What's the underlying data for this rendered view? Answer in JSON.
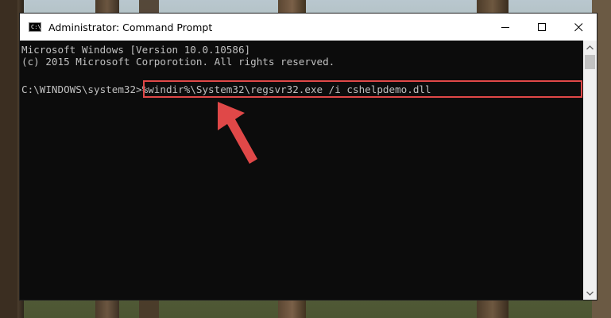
{
  "window": {
    "title": "Administrator: Command Prompt",
    "icon": "cmd-icon"
  },
  "controls": {
    "minimize": "minimize-icon",
    "maximize": "maximize-icon",
    "close": "close-icon"
  },
  "console": {
    "lines": [
      "Microsoft Windows [Version 10.0.10586]",
      "(c) 2015 Microsoft Corporotion. All rights reserved.",
      "",
      "C:\\WINDOWS\\system32>%windir%\\System32\\regsvr32.exe /i cshelpdemo.dll"
    ]
  },
  "annotation": {
    "highlight_color": "#e04848",
    "arrow_color": "#e04848"
  }
}
